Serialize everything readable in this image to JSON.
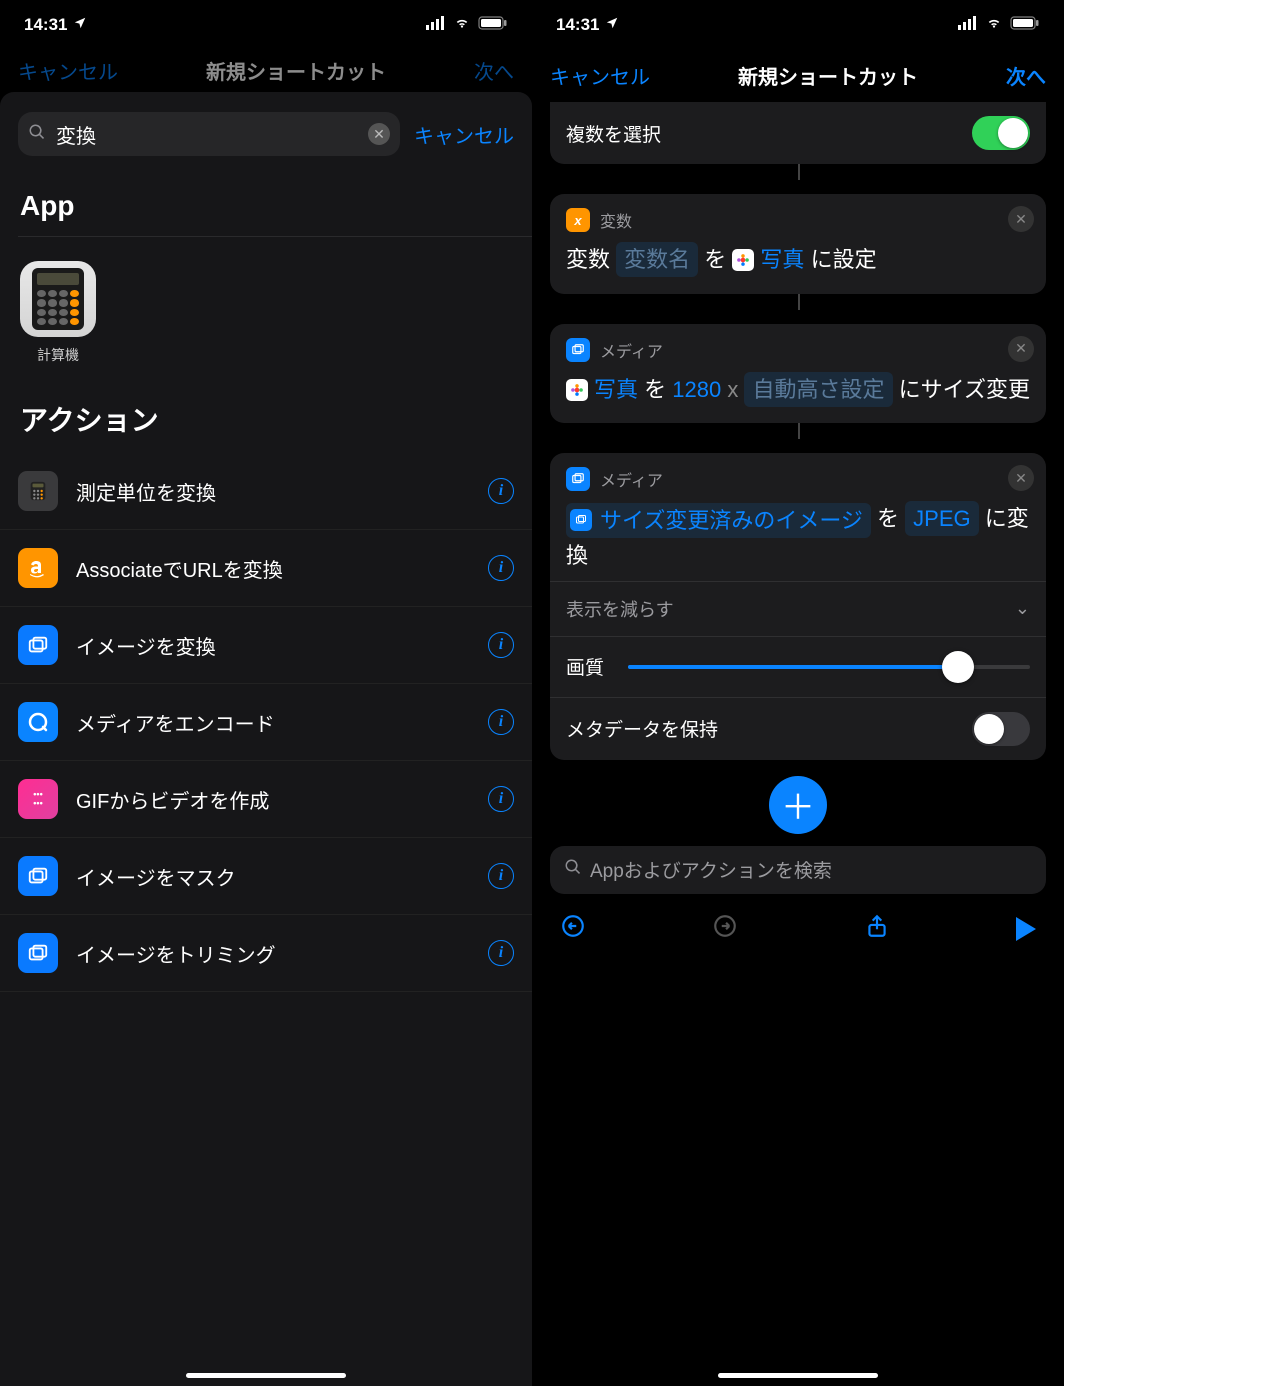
{
  "status": {
    "time": "14:31"
  },
  "left": {
    "dim_cancel": "キャンセル",
    "dim_title": "新規ショートカット",
    "dim_next": "次へ",
    "search": {
      "value": "変換",
      "cancel": "キャンセル"
    },
    "section_app": "App",
    "app": {
      "name": "計算機"
    },
    "section_actions": "アクション",
    "actions": [
      {
        "label": "測定単位を変換",
        "icon": "calc",
        "bg": "bg-grey"
      },
      {
        "label": "AssociateでURLを変換",
        "icon": "amazon",
        "bg": "bg-orange"
      },
      {
        "label": "イメージを変換",
        "icon": "images",
        "bg": "bg-blue"
      },
      {
        "label": "メディアをエンコード",
        "icon": "qt",
        "bg": "bg-cyan"
      },
      {
        "label": "GIFからビデオを作成",
        "icon": "gif",
        "bg": "bg-magenta"
      },
      {
        "label": "イメージをマスク",
        "icon": "images",
        "bg": "bg-blue"
      },
      {
        "label": "イメージをトリミング",
        "icon": "images",
        "bg": "bg-blue"
      }
    ]
  },
  "right": {
    "nav": {
      "cancel": "キャンセル",
      "title": "新規ショートカット",
      "next": "次へ"
    },
    "card_select": {
      "label": "複数を選択",
      "on": true
    },
    "card_var": {
      "header": "変数",
      "text1": "変数",
      "placeholder": "変数名",
      "text2": "を",
      "link": "写真",
      "text3": "に設定"
    },
    "card_resize": {
      "header": "メディア",
      "link1": "写真",
      "text1": "を",
      "width": "1280",
      "x": "x",
      "height_ph": "自動高さ設定",
      "text2": "にサイズ変更"
    },
    "card_convert": {
      "header": "メディア",
      "link1": "サイズ変更済みのイメージ",
      "text1": "を",
      "format": "JPEG",
      "text2": "に変換",
      "show_less": "表示を減らす",
      "quality_label": "画質",
      "quality_pct": 82,
      "meta_label": "メタデータを保持",
      "meta_on": false
    },
    "footer_search": "Appおよびアクションを検索"
  }
}
